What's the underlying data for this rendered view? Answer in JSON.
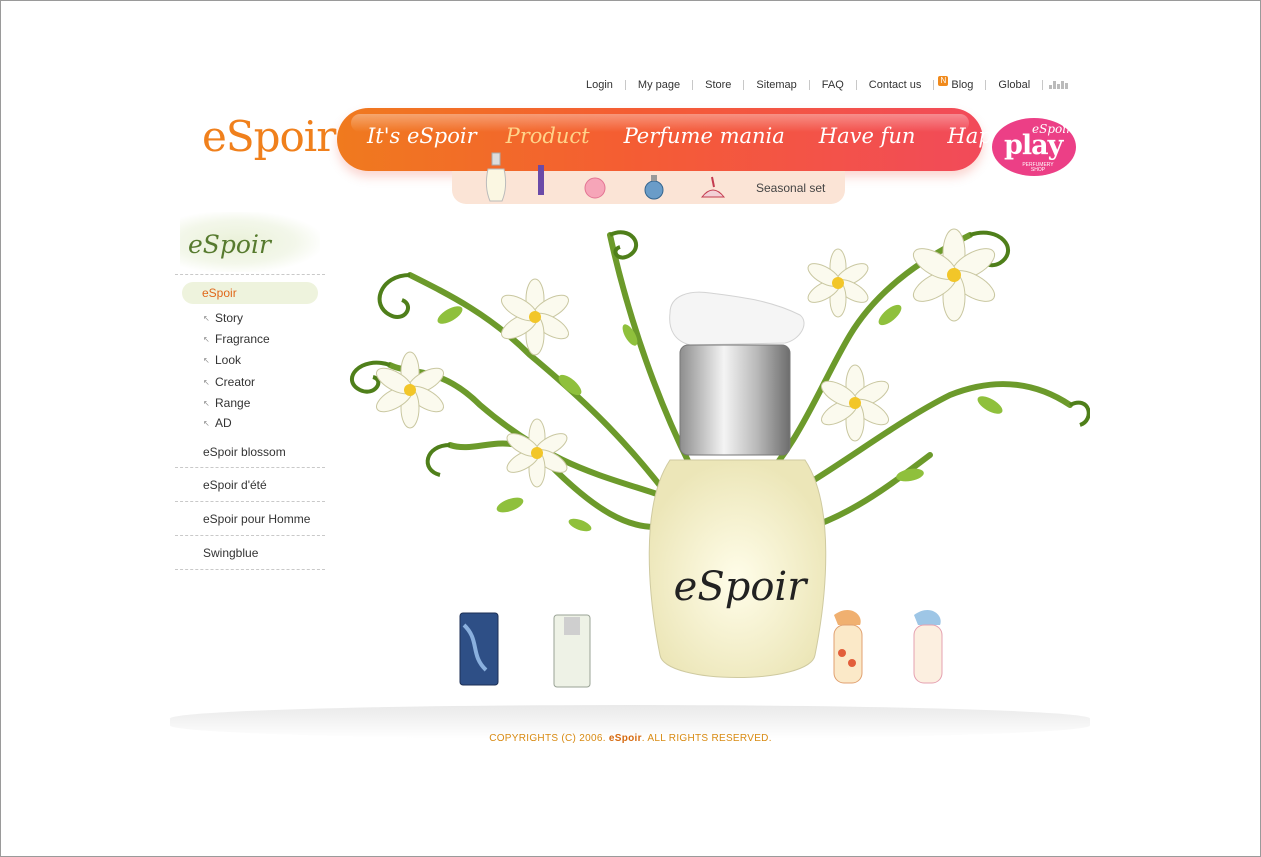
{
  "topnav": {
    "items": [
      "Login",
      "My page",
      "Store",
      "Sitemap",
      "FAQ",
      "Contact us",
      "Blog",
      "Global"
    ],
    "blog_badge": "N"
  },
  "logo": {
    "text": "eSpoir",
    "color": "#f0801c"
  },
  "mainnav": {
    "tabs": [
      "It's eSpoir",
      "Product",
      "Perfume mania",
      "Have fun",
      "Happy event"
    ],
    "active": "Product",
    "colors": [
      "#f07a1e",
      "#f24a5a"
    ]
  },
  "subnav": {
    "label": "Seasonal set"
  },
  "play_badge": {
    "top": "eSpoir",
    "main": "play",
    "sub": "PERFUMERY SHOP"
  },
  "sidebar": {
    "heading": "eSpoir",
    "active": "eSpoir",
    "sub_items": [
      "Story",
      "Fragrance",
      "Look",
      "Creator",
      "Range",
      "AD"
    ],
    "items": [
      "eSpoir blossom",
      "eSpoir d'été",
      "eSpoir pour Homme",
      "Swingblue"
    ]
  },
  "hero": {
    "bottle_label": "eSpoir"
  },
  "footer": {
    "pre": "COPYRIGHTS (C) 2006. ",
    "brand": "eSpoir",
    "post": ". ALL RIGHTS RESERVED."
  }
}
